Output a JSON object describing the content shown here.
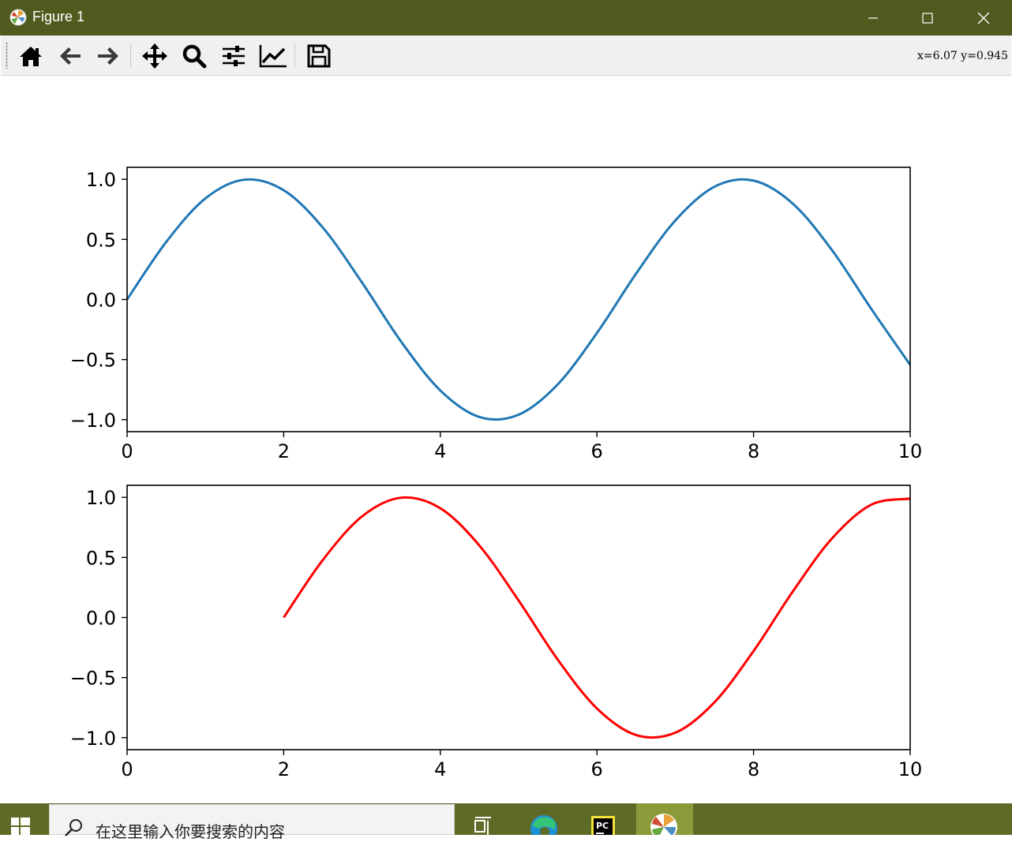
{
  "window": {
    "title": "Figure 1",
    "controls": [
      "minimize",
      "maximize",
      "close"
    ]
  },
  "toolbar": {
    "buttons": [
      {
        "name": "home",
        "icon": "home-icon"
      },
      {
        "name": "back",
        "icon": "arrow-left-icon"
      },
      {
        "name": "forward",
        "icon": "arrow-right-icon"
      },
      {
        "name": "pan",
        "icon": "move-icon"
      },
      {
        "name": "zoom",
        "icon": "magnifier-icon"
      },
      {
        "name": "subplots",
        "icon": "sliders-icon"
      },
      {
        "name": "customize",
        "icon": "line-chart-icon"
      },
      {
        "name": "save",
        "icon": "floppy-icon"
      }
    ],
    "coords_text": "x=6.07  y=0.945"
  },
  "chart_data": [
    {
      "type": "line",
      "title": "",
      "xlabel": "",
      "ylabel": "",
      "xlim": [
        0,
        10
      ],
      "ylim": [
        -1.1,
        1.1
      ],
      "xticks": [
        0,
        2,
        4,
        6,
        8,
        10
      ],
      "yticks": [
        1.0,
        0.5,
        0.0,
        -0.5,
        -1.0
      ],
      "xtick_labels": [
        "0",
        "2",
        "4",
        "6",
        "8",
        "10"
      ],
      "ytick_labels": [
        "1.0",
        "0.5",
        "0.0",
        "−0.5",
        "−1.0"
      ],
      "series": [
        {
          "color": "#1f77b4",
          "x": [
            0,
            0.5,
            1.0,
            1.5,
            2.0,
            2.5,
            3.0,
            3.5,
            4.0,
            4.5,
            5.0,
            5.5,
            6.0,
            6.5,
            7.0,
            7.5,
            8.0,
            8.5,
            9.0,
            9.5,
            10.0
          ],
          "y": [
            0.0,
            0.479,
            0.841,
            0.997,
            0.909,
            0.598,
            0.141,
            -0.351,
            -0.757,
            -0.978,
            -0.959,
            -0.706,
            -0.279,
            0.215,
            0.657,
            0.938,
            0.989,
            0.798,
            0.412,
            -0.075,
            -0.544
          ]
        }
      ],
      "grid": false
    },
    {
      "type": "line",
      "title": "",
      "xlabel": "",
      "ylabel": "",
      "xlim": [
        0,
        10
      ],
      "ylim": [
        -1.1,
        1.1
      ],
      "xticks": [
        0,
        2,
        4,
        6,
        8,
        10
      ],
      "yticks": [
        1.0,
        0.5,
        0.0,
        -0.5,
        -1.0
      ],
      "xtick_labels": [
        "0",
        "2",
        "4",
        "6",
        "8",
        "10"
      ],
      "ytick_labels": [
        "1.0",
        "0.5",
        "0.0",
        "−0.5",
        "−1.0"
      ],
      "series": [
        {
          "color": "#ff0000",
          "x": [
            2.0,
            2.5,
            3.0,
            3.5,
            4.0,
            4.5,
            5.0,
            5.5,
            6.0,
            6.5,
            7.0,
            7.5,
            8.0,
            8.5,
            9.0,
            9.5,
            10.0
          ],
          "y": [
            0.0,
            0.479,
            0.841,
            0.997,
            0.909,
            0.598,
            0.141,
            -0.351,
            -0.757,
            -0.978,
            -0.959,
            -0.706,
            -0.279,
            0.215,
            0.657,
            0.938,
            0.989
          ]
        }
      ],
      "grid": false
    }
  ],
  "taskbar": {
    "search_placeholder": "在这里输入你要搜索的内容",
    "apps": [
      "task-view-icon",
      "edge-icon",
      "pycharm-icon",
      "matplotlib-icon"
    ]
  }
}
